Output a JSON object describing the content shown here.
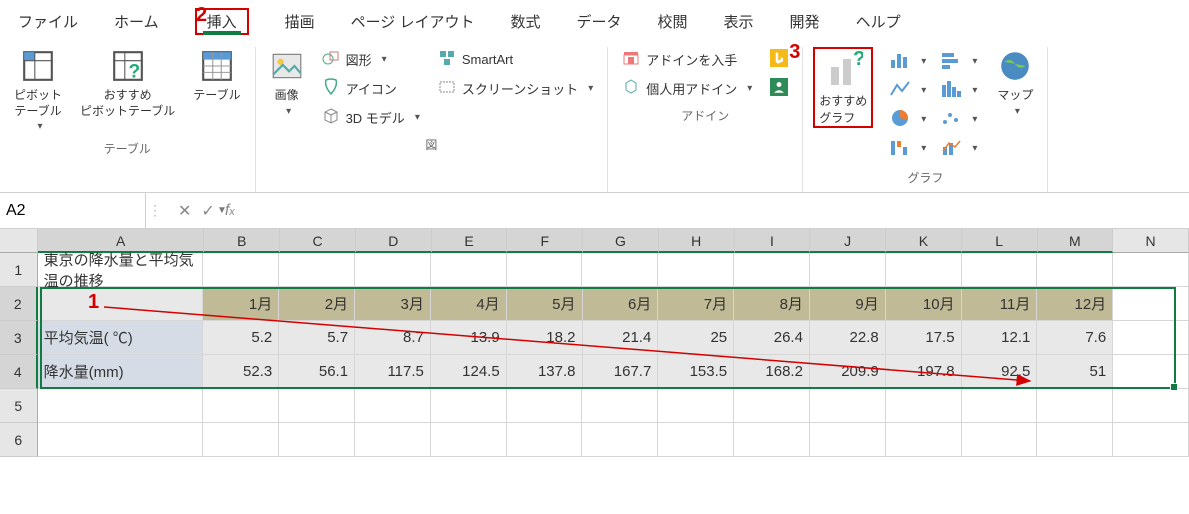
{
  "ribbonTabs": [
    "ファイル",
    "ホーム",
    "挿入",
    "描画",
    "ページ レイアウト",
    "数式",
    "データ",
    "校閲",
    "表示",
    "開発",
    "ヘルプ"
  ],
  "activeTabIndex": 2,
  "ribbon": {
    "tables": {
      "groupLabel": "テーブル",
      "pivot": "ピボット\nテーブル",
      "recPivot": "おすすめ\nピボットテーブル",
      "table": "テーブル"
    },
    "illust": {
      "groupLabel": "図",
      "image": "画像",
      "shapes": "図形",
      "icons": "アイコン",
      "model3d": "3D モデル",
      "smartart": "SmartArt",
      "screenshot": "スクリーンショット"
    },
    "addins": {
      "groupLabel": "アドイン",
      "get": "アドインを入手",
      "personal": "個人用アドイン"
    },
    "charts": {
      "groupLabel": "グラフ",
      "recommended": "おすすめ\nグラフ",
      "map": "マップ"
    }
  },
  "nameBox": "A2",
  "formula": "",
  "columns": [
    "A",
    "B",
    "C",
    "D",
    "E",
    "F",
    "G",
    "H",
    "I",
    "J",
    "K",
    "L",
    "M",
    "N"
  ],
  "rowNums": [
    "1",
    "2",
    "3",
    "4",
    "5",
    "6"
  ],
  "title": "東京の降水量と平均気温の推移",
  "headerRow": [
    "",
    "1月",
    "2月",
    "3月",
    "4月",
    "5月",
    "6月",
    "7月",
    "8月",
    "9月",
    "10月",
    "11月",
    "12月"
  ],
  "tempRow": [
    "平均気温( ℃)",
    "5.2",
    "5.7",
    "8.7",
    "13.9",
    "18.2",
    "21.4",
    "25",
    "26.4",
    "22.8",
    "17.5",
    "12.1",
    "7.6"
  ],
  "rainRow": [
    "降水量(mm)",
    "52.3",
    "56.1",
    "117.5",
    "124.5",
    "137.8",
    "167.7",
    "153.5",
    "168.2",
    "209.9",
    "197.8",
    "92.5",
    "51"
  ],
  "annotations": {
    "n1": "1",
    "n2": "2",
    "n3": "3"
  },
  "chart_data": {
    "type": "table",
    "title": "東京の降水量と平均気温の推移",
    "categories": [
      "1月",
      "2月",
      "3月",
      "4月",
      "5月",
      "6月",
      "7月",
      "8月",
      "9月",
      "10月",
      "11月",
      "12月"
    ],
    "series": [
      {
        "name": "平均気温( ℃)",
        "values": [
          5.2,
          5.7,
          8.7,
          13.9,
          18.2,
          21.4,
          25,
          26.4,
          22.8,
          17.5,
          12.1,
          7.6
        ]
      },
      {
        "name": "降水量(mm)",
        "values": [
          52.3,
          56.1,
          117.5,
          124.5,
          137.8,
          167.7,
          153.5,
          168.2,
          209.9,
          197.8,
          92.5,
          51
        ]
      }
    ]
  }
}
